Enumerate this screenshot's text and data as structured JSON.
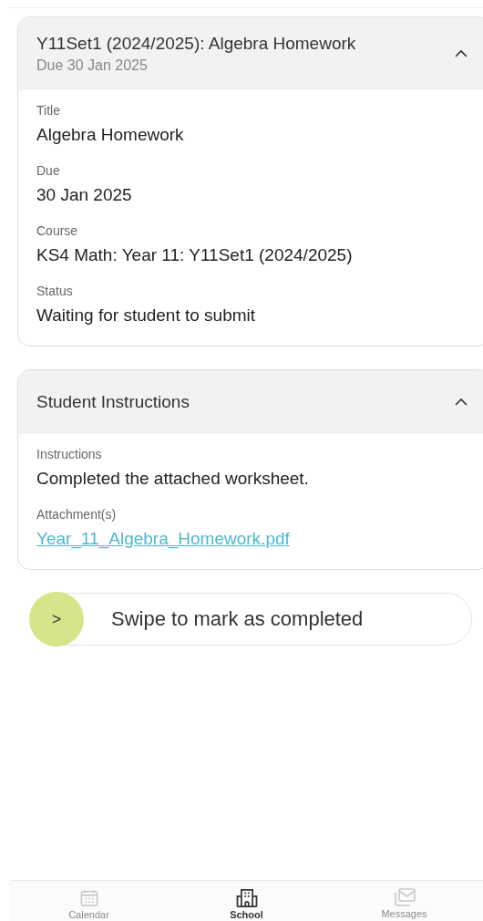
{
  "cards": [
    {
      "title": "Y11Set1 (2024/2025): Algebra Homework",
      "subtitle": "Due 30 Jan 2025",
      "expanded": true,
      "fields": [
        {
          "label": "Title",
          "value": "Algebra Homework",
          "kind": "text"
        },
        {
          "label": "Due",
          "value": "30 Jan 2025",
          "kind": "text"
        },
        {
          "label": "Course",
          "value": "KS4 Math: Year 11: Y11Set1 (2024/2025)",
          "kind": "text"
        },
        {
          "label": "Status",
          "value": "Waiting for student to submit",
          "kind": "text"
        }
      ]
    },
    {
      "title": "Student Instructions",
      "expanded": true,
      "fields": [
        {
          "label": "Instructions",
          "value": "Completed the attached worksheet.",
          "kind": "text"
        },
        {
          "label": "Attachment(s)",
          "value": "Year_11_Algebra_Homework.pdf",
          "kind": "link"
        }
      ]
    }
  ],
  "swipe": {
    "label": "Swipe to mark as completed",
    "handle": ">"
  },
  "nav": [
    {
      "label": "Calendar",
      "selected": false
    },
    {
      "label": "School",
      "selected": true
    },
    {
      "label": "Messages",
      "selected": false
    }
  ]
}
